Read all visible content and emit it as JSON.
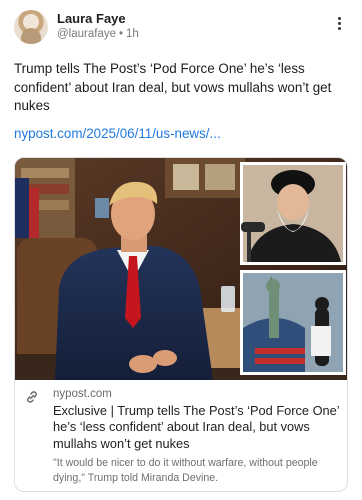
{
  "post": {
    "author_name": "Laura Faye",
    "handle": "@laurafaye",
    "separator": "•",
    "time_ago": "1h",
    "text": "Trump tells The Post’s ‘Pod Force One’ he’s ‘less confident’ about Iran deal, but vows mullahs won’t get nukes",
    "link_text": "nypost.com/2025/06/11/us-news/..."
  },
  "card": {
    "domain": "nypost.com",
    "title": "Exclusive | Trump tells The Post’s ‘Pod Force One’ he’s ‘less confident’ about Iran deal, but vows mullahs won’t get nukes",
    "description": "\"It would be nicer to do it without warfare, without people dying,\" Trump told Miranda Devine."
  },
  "colors": {
    "link": "#1f7ae0",
    "text": "#1d1d1d",
    "muted": "#6f6f6f",
    "card_border": "#dcdfe4"
  },
  "icons": {
    "more": "vertical-ellipsis",
    "link": "chain-link"
  }
}
